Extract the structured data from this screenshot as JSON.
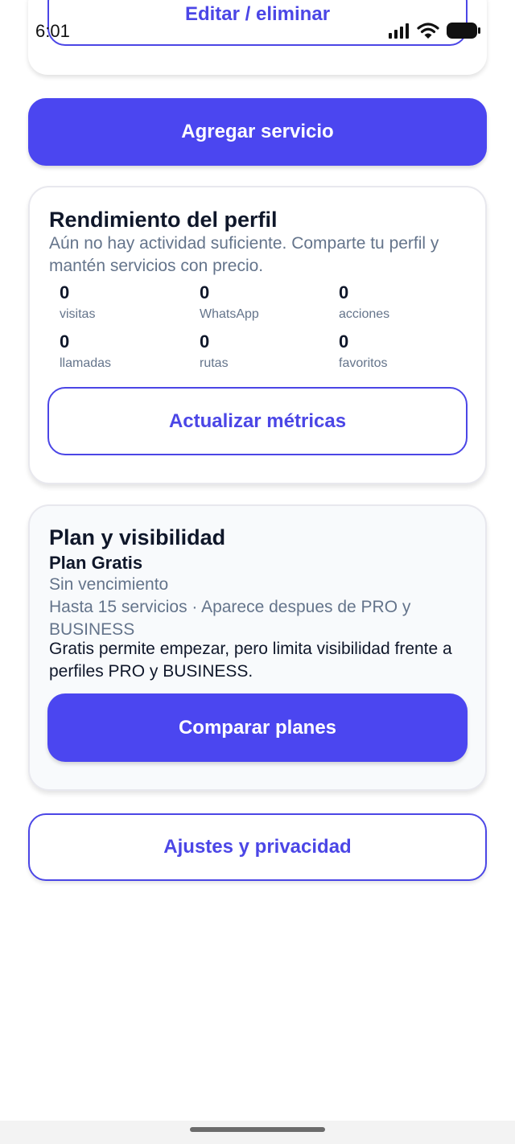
{
  "status_bar": {
    "time": "6:01"
  },
  "top_card": {
    "edit_button": "Editar / eliminar"
  },
  "add_service_button": "Agregar servicio",
  "performance": {
    "title": "Rendimiento del perfil",
    "description_line1": "Aún no hay actividad suficiente. Comparte tu perfil y",
    "description_line2": "mantén servicios con precio.",
    "metrics": [
      {
        "value": "0",
        "label": "visitas"
      },
      {
        "value": "0",
        "label": "WhatsApp"
      },
      {
        "value": "0",
        "label": "acciones"
      },
      {
        "value": "0",
        "label": "llamadas"
      },
      {
        "value": "0",
        "label": "rutas"
      },
      {
        "value": "0",
        "label": "favoritos"
      }
    ],
    "refresh_button": "Actualizar métricas"
  },
  "plan": {
    "title": "Plan y visibilidad",
    "plan_name": "Plan Gratis",
    "expiry": "Sin vencimiento",
    "limits_line1": "Hasta 15 servicios · Aparece despues de PRO y",
    "limits_line2": "BUSINESS",
    "note_line1": "Gratis permite empezar, pero limita visibilidad frente a",
    "note_line2": "perfiles PRO y BUSINESS.",
    "compare_button": "Comparar planes"
  },
  "settings_button": "Ajustes y privacidad",
  "colors": {
    "accent": "#4b46f0",
    "muted_text": "#64748b",
    "plan_card_bg": "#f8fafc"
  }
}
